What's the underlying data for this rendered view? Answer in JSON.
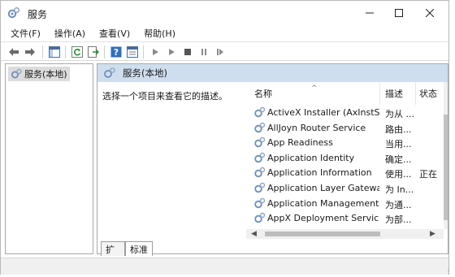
{
  "window": {
    "title": "服务"
  },
  "menu": [
    "文件(F)",
    "操作(A)",
    "查看(V)",
    "帮助(H)"
  ],
  "toolbar": {
    "icons": [
      "back-arrow-icon",
      "forward-arrow-icon",
      "console-tree-icon",
      "refresh-icon",
      "export-list-icon",
      "help-icon",
      "properties-icon",
      "start-service-icon",
      "stop-service-icon",
      "pause-service-icon",
      "restart-service-icon"
    ]
  },
  "tree": {
    "item": "服务(本地)"
  },
  "right_pane": {
    "header": "服务(本地)",
    "description_prompt": "选择一个项目来查看它的描述。"
  },
  "list": {
    "columns": [
      "名称",
      "描述",
      "状态"
    ],
    "rows": [
      {
        "name": "ActiveX Installer (AxInstSV)",
        "desc": "为从 ...",
        "status": ""
      },
      {
        "name": "AllJoyn Router Service",
        "desc": "路由...",
        "status": ""
      },
      {
        "name": "App Readiness",
        "desc": "当用...",
        "status": ""
      },
      {
        "name": "Application Identity",
        "desc": "确定...",
        "status": ""
      },
      {
        "name": "Application Information",
        "desc": "使用...",
        "status": "正在"
      },
      {
        "name": "Application Layer Gatewa...",
        "desc": "为 In...",
        "status": ""
      },
      {
        "name": "Application Management",
        "desc": "为通...",
        "status": ""
      },
      {
        "name": "AppX Deployment Servic...",
        "desc": "为部...",
        "status": ""
      }
    ]
  },
  "tabs": [
    "扩展",
    "标准"
  ],
  "colors": {
    "header_bg": "#cfdeee",
    "selection_bg": "#dcdcdc",
    "icon_blue": "#2f6fbf"
  }
}
